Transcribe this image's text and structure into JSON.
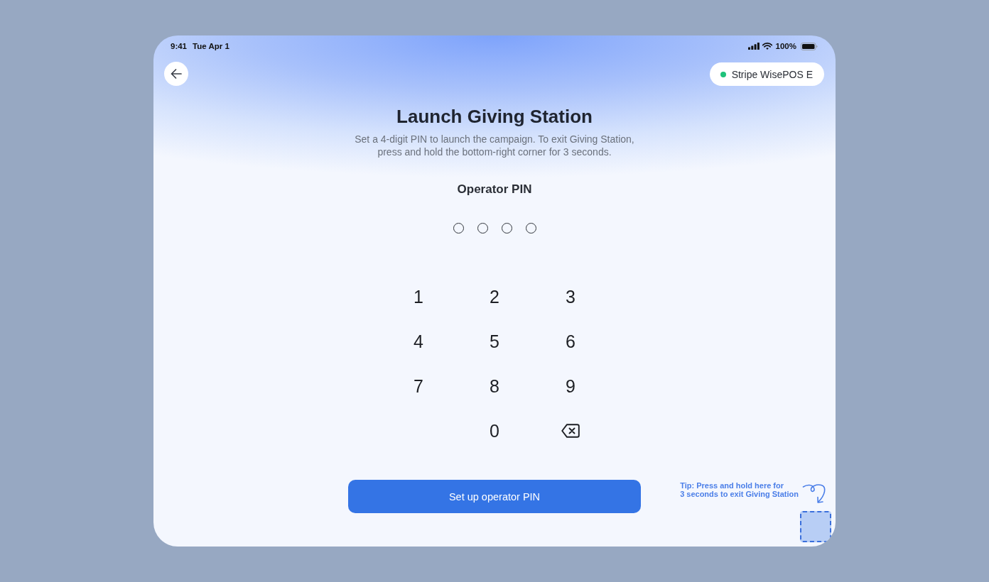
{
  "status_bar": {
    "time": "9:41",
    "date": "Tue Apr 1",
    "battery": "100%"
  },
  "header": {
    "device": {
      "name": "Stripe WisePOS E",
      "connected": true
    }
  },
  "title": "Launch Giving Station",
  "subtitle": "Set a 4-digit PIN to launch the campaign. To exit Giving Station, press and hold the bottom-right corner for 3 seconds.",
  "pin": {
    "label": "Operator PIN",
    "dots": [
      {
        "filled": false
      },
      {
        "filled": false
      },
      {
        "filled": false
      },
      {
        "filled": false
      }
    ]
  },
  "keypad": {
    "rows": [
      [
        {
          "kind": "digit",
          "label": "1"
        },
        {
          "kind": "digit",
          "label": "2"
        },
        {
          "kind": "digit",
          "label": "3"
        }
      ],
      [
        {
          "kind": "digit",
          "label": "4"
        },
        {
          "kind": "digit",
          "label": "5"
        },
        {
          "kind": "digit",
          "label": "6"
        }
      ],
      [
        {
          "kind": "digit",
          "label": "7"
        },
        {
          "kind": "digit",
          "label": "8"
        },
        {
          "kind": "digit",
          "label": "9"
        }
      ],
      [
        "",
        {
          "kind": "digit",
          "label": "0"
        },
        {
          "kind": "backspace"
        }
      ]
    ]
  },
  "primary_button": "Set up operator PIN",
  "exit_tip": "Tip: Press and hold here for\n3 seconds to exit Giving Station"
}
